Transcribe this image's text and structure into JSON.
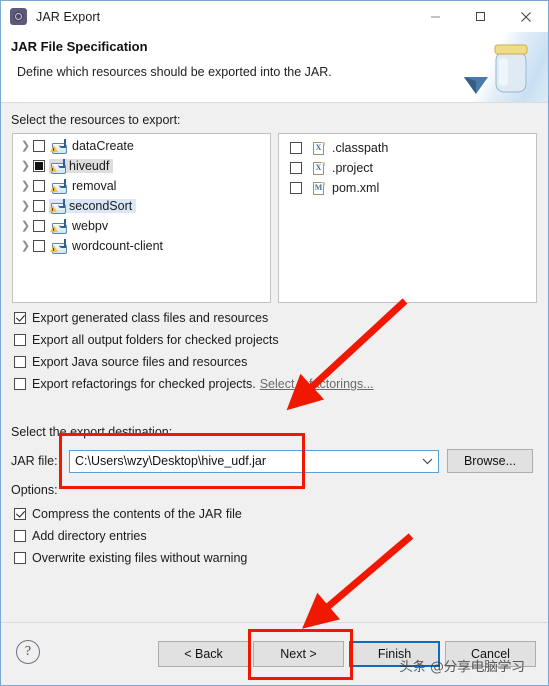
{
  "window": {
    "title": "JAR Export",
    "icon": "jar-export-gear-icon",
    "controls": {
      "minimize": "–",
      "maximize": "□",
      "close": "✕"
    }
  },
  "header": {
    "title": "JAR File Specification",
    "description": "Define which resources should be exported into the JAR.",
    "art_icon": "jar-with-arrow-banner-icon"
  },
  "resources": {
    "label": "Select the resources to export:",
    "tree": [
      {
        "name": "dataCreate",
        "checkbox": "unchecked",
        "expandable": true,
        "highlight": "none",
        "icon": "java-project-icon"
      },
      {
        "name": "hiveudf",
        "checkbox": "filled",
        "expandable": true,
        "highlight": "gray",
        "icon": "java-project-icon"
      },
      {
        "name": "removal",
        "checkbox": "unchecked",
        "expandable": true,
        "highlight": "none",
        "icon": "java-project-icon"
      },
      {
        "name": "secondSort",
        "checkbox": "unchecked",
        "expandable": true,
        "highlight": "blue",
        "icon": "java-project-icon"
      },
      {
        "name": "webpv",
        "checkbox": "unchecked",
        "expandable": true,
        "highlight": "none",
        "icon": "java-project-icon"
      },
      {
        "name": "wordcount-client",
        "checkbox": "unchecked",
        "expandable": true,
        "highlight": "none",
        "icon": "java-project-icon"
      }
    ],
    "files": [
      {
        "name": ".classpath",
        "checkbox": "unchecked",
        "icon": "xml-file-icon",
        "letter": "X"
      },
      {
        "name": ".project",
        "checkbox": "unchecked",
        "icon": "xml-file-icon",
        "letter": "X"
      },
      {
        "name": "pom.xml",
        "checkbox": "unchecked",
        "icon": "maven-file-icon",
        "letter": "M"
      }
    ]
  },
  "export_options": [
    {
      "label": "Export generated class files and resources",
      "checked": true
    },
    {
      "label": "Export all output folders for checked projects",
      "checked": false
    },
    {
      "label": "Export Java source files and resources",
      "checked": false
    },
    {
      "label": "Export refactorings for checked projects.",
      "checked": false,
      "link": "Select refactorings..."
    }
  ],
  "destination": {
    "label": "Select the export destination:",
    "jar_file_label": "JAR file:",
    "jar_file_value": "C:\\Users\\wzy\\Desktop\\hive_udf.jar",
    "browse_label": "Browse...",
    "dropdown_icon": "chevron-down-icon"
  },
  "options": {
    "label": "Options:",
    "items": [
      {
        "label": "Compress the contents of the JAR file",
        "checked": true
      },
      {
        "label": "Add directory entries",
        "checked": false
      },
      {
        "label": "Overwrite existing files without warning",
        "checked": false
      }
    ]
  },
  "footer": {
    "help_icon": "help-question-icon",
    "back_label": "< Back",
    "next_label": "Next >",
    "finish_label": "Finish",
    "cancel_label": "Cancel"
  },
  "annotations": {
    "accent_color": "#f01800",
    "focus_color": "#0a6cc4",
    "watermark": "头条 @分享电脑学习"
  }
}
